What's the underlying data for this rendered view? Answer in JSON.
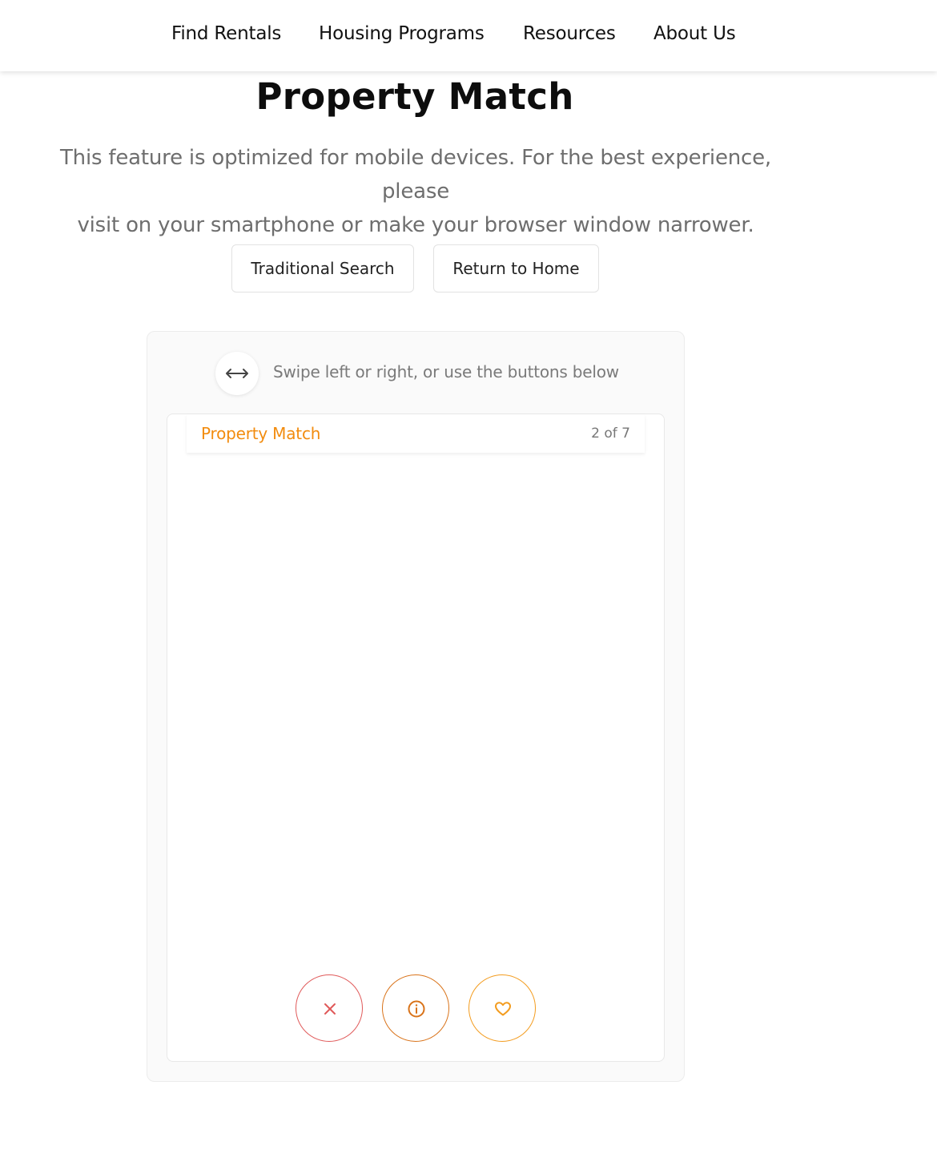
{
  "nav": {
    "items": [
      {
        "label": "Find Rentals"
      },
      {
        "label": "Housing Programs"
      },
      {
        "label": "Resources"
      },
      {
        "label": "About Us"
      }
    ]
  },
  "page": {
    "title": "Property Match",
    "intro_line1": "This feature is optimized for mobile devices. For the best experience, please",
    "intro_line2": "visit on your smartphone or make your browser window narrower."
  },
  "actions": {
    "traditional_search_label": "Traditional Search",
    "return_home_label": "Return to Home"
  },
  "swipe": {
    "hint": "Swipe left or right, or use the buttons below",
    "icon": "left-right-arrow-icon"
  },
  "card": {
    "title": "Property Match",
    "counter": "2 of 7",
    "accent_color": "#f28c0f"
  },
  "card_actions": [
    {
      "name": "dislike",
      "icon": "close-icon",
      "color": "#e05a5a"
    },
    {
      "name": "info",
      "icon": "info-icon",
      "color": "#d9731a"
    },
    {
      "name": "like",
      "icon": "heart-icon",
      "color": "#f39c1f"
    }
  ]
}
